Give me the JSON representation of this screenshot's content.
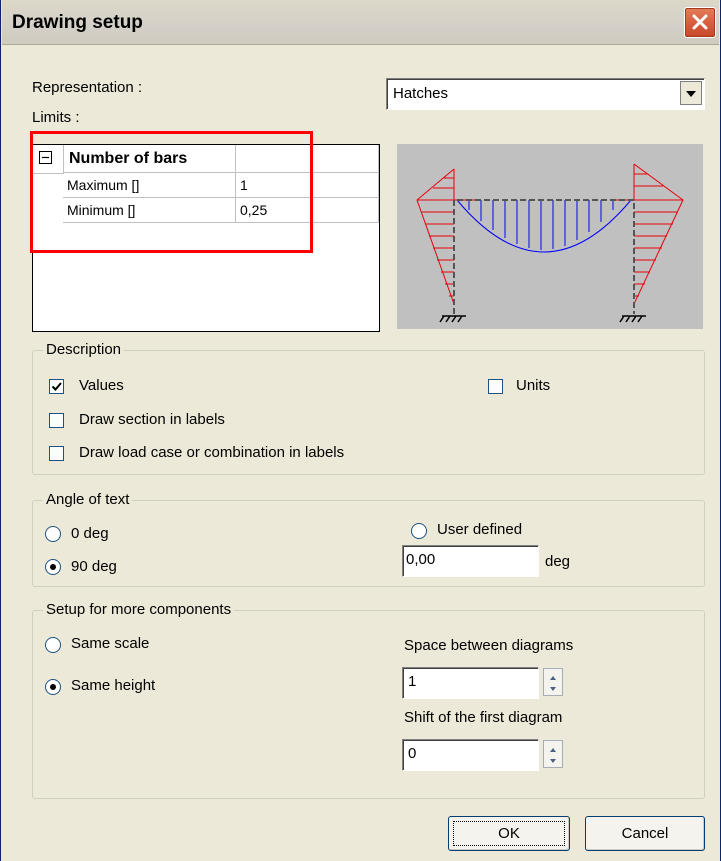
{
  "window": {
    "title": "Drawing setup"
  },
  "representation": {
    "label": "Representation :",
    "selected": "Hatches"
  },
  "limits": {
    "label": "Limits :",
    "group_title": "Number of bars",
    "rows": [
      {
        "name": "Maximum []",
        "value": "1"
      },
      {
        "name": "Minimum []",
        "value": "0,25"
      }
    ]
  },
  "description": {
    "title": "Description",
    "values_label": "Values",
    "values_checked": true,
    "units_label": "Units",
    "units_checked": false,
    "draw_section_label": "Draw section in labels",
    "draw_section_checked": false,
    "draw_load_case_label": "Draw load case or combination in labels",
    "draw_load_case_checked": false
  },
  "angle": {
    "title": "Angle of text",
    "option_0": "0 deg",
    "option_90": "90 deg",
    "option_user": "User defined",
    "selected": "90 deg",
    "user_value": "0,00",
    "unit": "deg"
  },
  "components": {
    "title": "Setup for more components",
    "same_scale": "Same scale",
    "same_height": "Same height",
    "selected": "Same height",
    "space_label": "Space between diagrams",
    "space_value": "1",
    "shift_label": "Shift of the first diagram",
    "shift_value": "0"
  },
  "buttons": {
    "ok": "OK",
    "cancel": "Cancel"
  },
  "colors": {
    "highlight": "#ff0000",
    "hatch_negative": "#e8000b",
    "hatch_positive": "#0000ff"
  },
  "icons": [
    "close-icon",
    "dropdown-arrow-icon",
    "collapse-icon",
    "check-icon",
    "spin-up-icon",
    "spin-down-icon"
  ]
}
